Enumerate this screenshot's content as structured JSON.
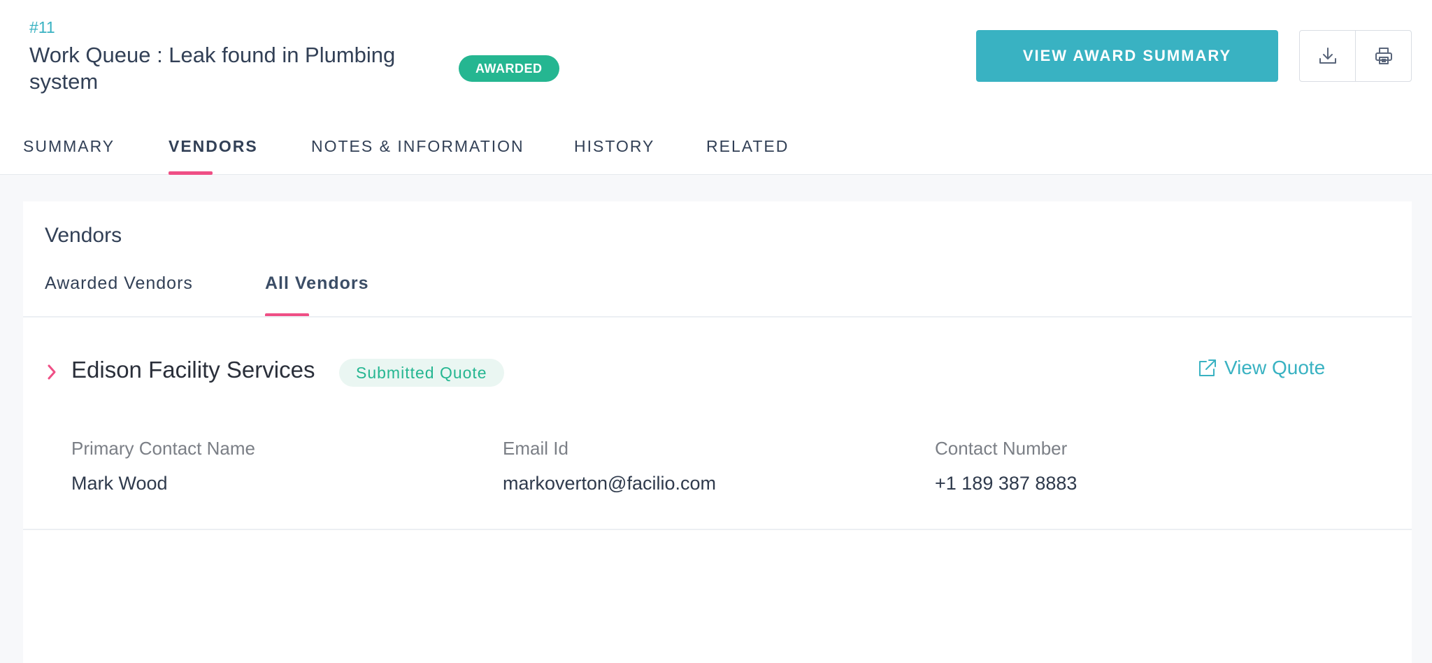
{
  "header": {
    "record_id": "#11",
    "title": "Work Queue : Leak found in Plumbing system",
    "status_badge": "AWARDED",
    "award_button_label": "VIEW AWARD SUMMARY",
    "download_icon": "download-icon",
    "print_icon": "print-icon"
  },
  "tabs": [
    {
      "label": "SUMMARY",
      "active": false
    },
    {
      "label": "VENDORS",
      "active": true
    },
    {
      "label": "NOTES & INFORMATION",
      "active": false
    },
    {
      "label": "HISTORY",
      "active": false
    },
    {
      "label": "RELATED",
      "active": false
    }
  ],
  "vendors_card": {
    "title": "Vendors",
    "subtabs": [
      {
        "label": "Awarded Vendors",
        "active": false
      },
      {
        "label": "All Vendors",
        "active": true
      }
    ],
    "vendor": {
      "name": "Edison Facility Services",
      "status": "Submitted Quote",
      "view_quote_label": "View Quote",
      "fields": [
        {
          "label": "Primary Contact Name",
          "value": "Mark Wood"
        },
        {
          "label": "Email Id",
          "value": "markoverton@facilio.com"
        },
        {
          "label": "Contact Number",
          "value": "+1 189 387 8883"
        }
      ]
    }
  },
  "colors": {
    "accent_teal": "#39b2c2",
    "awarded_green": "#25b691",
    "active_underline": "#ef4f85",
    "text_dark": "#324056"
  }
}
